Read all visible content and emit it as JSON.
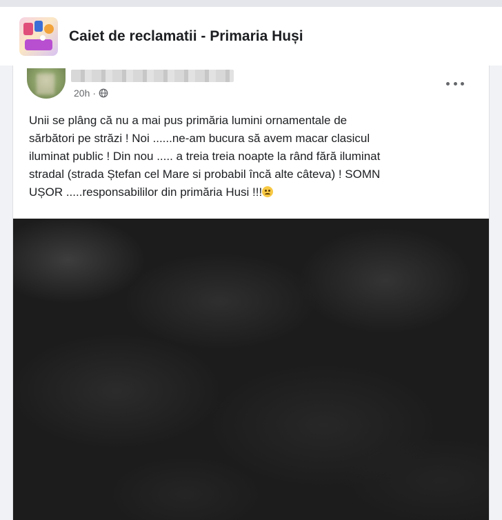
{
  "group": {
    "title": "Caiet de reclamatii - Primaria Huși"
  },
  "post": {
    "timestamp": "20h",
    "separator": "·",
    "privacy_icon": "globe-icon",
    "more_icon": "more-options-icon",
    "text": "Unii se plâng că nu a mai pus primăria lumini ornamentale de\nsărbători pe străzi ! Noi ......ne-am bucura să avem macar clasicul\niluminat public ! Din nou ..... a treia treia noapte la rând fără iluminat\nstradal (strada Ștefan cel Mare si probabil încă alte câteva) ! SOMN\nUȘOR .....responsabililor din primăria Husi !!!",
    "emoji": "sad-face-emoji"
  }
}
